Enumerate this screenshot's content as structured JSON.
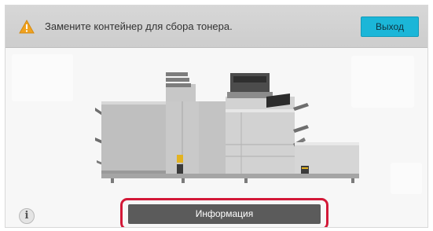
{
  "header": {
    "message": "Замените контейнер для сбора тонера.",
    "warning_icon": "warning-triangle-icon",
    "exit_label": "Выход"
  },
  "machine_illustration": {
    "icon": "printer-machine-illustration"
  },
  "footer": {
    "info_icon": "info-icon",
    "info_icon_glyph": "i",
    "info_button_label": "Информация"
  },
  "colors": {
    "accent": "#1bb6d8",
    "highlight": "#d31837",
    "warning": "#f39c12",
    "button_dark": "#5b5b5b"
  }
}
